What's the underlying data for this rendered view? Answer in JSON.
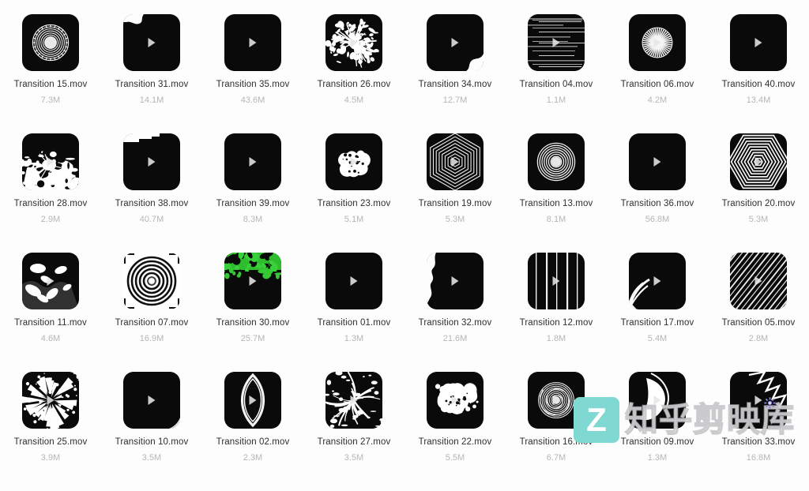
{
  "window": {
    "background_color": "#fdfdfd",
    "view_mode": "icon-grid",
    "columns": 8,
    "rows": 4
  },
  "watermark": {
    "logo_letter": "Z",
    "logo_color": "#7fd9d2",
    "text": "知乎剪映库",
    "gear_icon_color": "#8b86d8"
  },
  "files": [
    {
      "name": "Transition 15.mov",
      "size": "7.3M",
      "art": "rings-ribbed",
      "light": false
    },
    {
      "name": "Transition 31.mov",
      "size": "14.1M",
      "art": "notch-tl",
      "light": false
    },
    {
      "name": "Transition 35.mov",
      "size": "43.6M",
      "art": "plain",
      "light": false
    },
    {
      "name": "Transition 26.mov",
      "size": "4.5M",
      "art": "splat-burst",
      "light": false
    },
    {
      "name": "Transition 34.mov",
      "size": "12.7M",
      "art": "notch-br",
      "light": false
    },
    {
      "name": "Transition 04.mov",
      "size": "1.1M",
      "art": "h-streaks",
      "light": false
    },
    {
      "name": "Transition 06.mov",
      "size": "4.2M",
      "art": "radial-fan",
      "light": false
    },
    {
      "name": "Transition 40.mov",
      "size": "13.4M",
      "art": "plain",
      "light": false
    },
    {
      "name": "Transition 28.mov",
      "size": "2.9M",
      "art": "ink-splash",
      "light": false
    },
    {
      "name": "Transition 38.mov",
      "size": "40.7M",
      "art": "corner-fold",
      "light": false
    },
    {
      "name": "Transition 39.mov",
      "size": "8.3M",
      "art": "plain",
      "light": false
    },
    {
      "name": "Transition 23.mov",
      "size": "5.1M",
      "art": "cloud-blob",
      "light": false
    },
    {
      "name": "Transition 19.mov",
      "size": "5.3M",
      "art": "hex-rings",
      "light": false
    },
    {
      "name": "Transition 13.mov",
      "size": "8.1M",
      "art": "concentric",
      "light": false
    },
    {
      "name": "Transition 36.mov",
      "size": "56.8M",
      "art": "plain",
      "light": false
    },
    {
      "name": "Transition 20.mov",
      "size": "5.3M",
      "art": "hex-rings-wide",
      "light": false
    },
    {
      "name": "Transition 11.mov",
      "size": "4.6M",
      "art": "blobs-scatter",
      "light": false
    },
    {
      "name": "Transition 07.mov",
      "size": "16.9M",
      "art": "rings-inverted",
      "light": true
    },
    {
      "name": "Transition 30.mov",
      "size": "25.7M",
      "art": "green-foliage",
      "light": false
    },
    {
      "name": "Transition 01.mov",
      "size": "1.3M",
      "art": "plain",
      "light": false
    },
    {
      "name": "Transition 32.mov",
      "size": "21.6M",
      "art": "edge-tear-left",
      "light": false
    },
    {
      "name": "Transition 12.mov",
      "size": "1.8M",
      "art": "v-bars",
      "light": false
    },
    {
      "name": "Transition 17.mov",
      "size": "5.4M",
      "art": "swoosh-corner",
      "light": false
    },
    {
      "name": "Transition 05.mov",
      "size": "2.8M",
      "art": "diag-stripes",
      "light": false
    },
    {
      "name": "Transition 25.mov",
      "size": "3.9M",
      "art": "shatter",
      "light": false
    },
    {
      "name": "Transition 10.mov",
      "size": "3.5M",
      "art": "corner-peel-br",
      "light": false
    },
    {
      "name": "Transition 02.mov",
      "size": "2.3M",
      "art": "lens-oval",
      "light": false
    },
    {
      "name": "Transition 27.mov",
      "size": "3.5M",
      "art": "crack-burst",
      "light": false
    },
    {
      "name": "Transition 22.mov",
      "size": "5.5M",
      "art": "smoke-puff",
      "light": false
    },
    {
      "name": "Transition 16.mov",
      "size": "6.7M",
      "art": "spiral-disc",
      "light": false
    },
    {
      "name": "Transition 09.mov",
      "size": "1.3M",
      "art": "swipe-wedge",
      "light": false
    },
    {
      "name": "Transition 33.mov",
      "size": "16.8M",
      "art": "torn-diagonal",
      "light": false
    }
  ]
}
